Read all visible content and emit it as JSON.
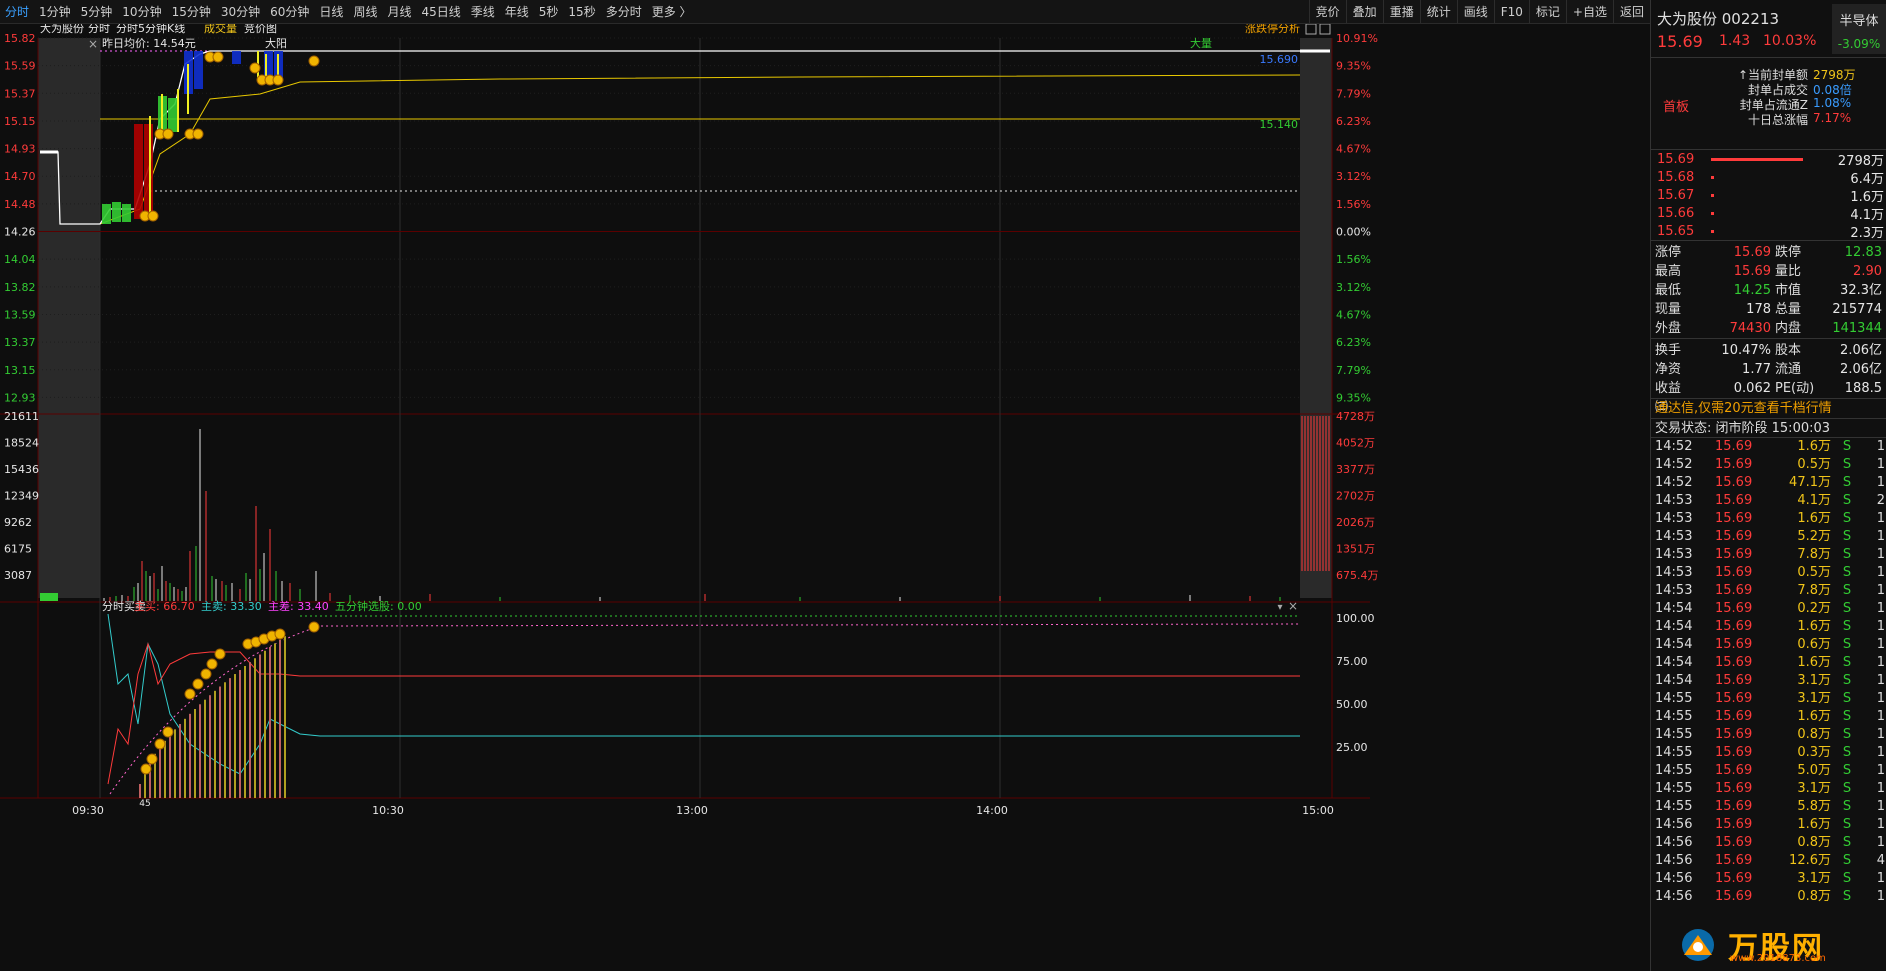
{
  "toolbar": {
    "periods": [
      "分时",
      "1分钟",
      "5分钟",
      "10分钟",
      "15分钟",
      "30分钟",
      "60分钟",
      "日线",
      "周线",
      "月线",
      "45日线",
      "季线",
      "年线",
      "5秒",
      "15秒",
      "多分时",
      "更多 〉"
    ],
    "right": [
      "竞价",
      "叠加",
      "重播",
      "统计",
      "画线",
      "F10",
      "标记",
      "+自选",
      "返回"
    ]
  },
  "chart": {
    "stock_name": "大为股份",
    "tabs": [
      "分时",
      "分时5分钟K线",
      "成交量",
      "竞价图"
    ],
    "prev_avg": "昨日均价: 14.54元",
    "analysis": "涨跌停分析",
    "label_dayang": "大阳",
    "label_daliang": "大量",
    "line_label_1": "15.690",
    "line_label_2": "15.140",
    "price_left": [
      "15.82",
      "15.59",
      "15.37",
      "15.15",
      "14.93",
      "14.70",
      "14.48",
      "14.26",
      "14.04",
      "13.82",
      "13.59",
      "13.37",
      "13.15",
      "12.93"
    ],
    "pct_right": [
      "10.91%",
      "9.35%",
      "7.79%",
      "6.23%",
      "4.67%",
      "3.12%",
      "1.56%",
      "0.00%",
      "1.56%",
      "3.12%",
      "4.67%",
      "6.23%",
      "7.79%",
      "9.35%"
    ],
    "vol_left": [
      "21611",
      "18524",
      "15436",
      "12349",
      "9262",
      "6175",
      "3087"
    ],
    "vol_right": [
      "4728万",
      "4052万",
      "3377万",
      "2702万",
      "2026万",
      "1351万",
      "675.4万"
    ],
    "ind_title": "分时买卖",
    "ind_buy": "主买: 66.70",
    "ind_sell": "主卖: 33.30",
    "ind_diff": "主差: 33.40",
    "ind_pick": "五分钟选股: 0.00",
    "ind_right": [
      "100.00",
      "75.00",
      "50.00",
      "25.00"
    ],
    "time_labels": [
      "09:30",
      "10:30",
      "13:00",
      "14:00",
      "15:00"
    ],
    "extra_tick": "45"
  },
  "colors": {
    "up": "#ff3b3b",
    "down": "#33cc33",
    "avg": "#e8c800",
    "grid": "#3a0000",
    "bg": "#0e0e0e"
  },
  "panel": {
    "name": "大为股份 002213",
    "price": "15.69",
    "change": "1.43",
    "pct": "10.03%",
    "sector_name": "半导体",
    "sector_pct": "-3.09%",
    "seal_label": "首板",
    "seal": [
      {
        "k": "↑当前封单额",
        "v": "2798万",
        "c": "yellow"
      },
      {
        "k": "封单占成交",
        "v": "0.08倍",
        "c": "blue"
      },
      {
        "k": "封单占流通Z",
        "v": "1.08%",
        "c": "blue"
      },
      {
        "k": "十日总涨幅",
        "v": "7.17%",
        "c": "red"
      }
    ],
    "book": [
      {
        "p": "15.69",
        "v": "2798万",
        "w": 92
      },
      {
        "p": "15.68",
        "v": "6.4万",
        "w": 3
      },
      {
        "p": "15.67",
        "v": "1.6万",
        "w": 3
      },
      {
        "p": "15.66",
        "v": "4.1万",
        "w": 3
      },
      {
        "p": "15.65",
        "v": "2.3万",
        "w": 3
      }
    ],
    "stats1": [
      {
        "k": "涨停",
        "v": "15.69",
        "vc": "red",
        "k2": "跌停",
        "v2": "12.83",
        "v2c": "green"
      },
      {
        "k": "最高",
        "v": "15.69",
        "vc": "red",
        "k2": "量比",
        "v2": "2.90",
        "v2c": "red"
      },
      {
        "k": "最低",
        "v": "14.25",
        "vc": "green",
        "k2": "市值",
        "v2": "32.3亿",
        "v2c": "white"
      },
      {
        "k": "现量",
        "v": "178",
        "vc": "white",
        "k2": "总量",
        "v2": "215774",
        "v2c": "white"
      },
      {
        "k": "外盘",
        "v": "74430",
        "vc": "red",
        "k2": "内盘",
        "v2": "141344",
        "v2c": "green"
      }
    ],
    "stats2": [
      {
        "k": "换手",
        "v": "10.47%",
        "vc": "white",
        "k2": "股本",
        "v2": "2.06亿",
        "v2c": "white"
      },
      {
        "k": "净资",
        "v": "1.77",
        "vc": "white",
        "k2": "流通",
        "v2": "2.06亿",
        "v2c": "white"
      },
      {
        "k": "收益㈢",
        "v": "0.062",
        "vc": "white",
        "k2": "PE(动)",
        "v2": "188.5",
        "v2c": "white"
      }
    ],
    "promo": "通达信,仅需20元查看千档行情",
    "trade_state": "交易状态: 闭市阶段 15:00:03",
    "ticks": [
      {
        "t": "14:52",
        "p": "15.69",
        "v": "1.6万",
        "d": "S",
        "n": "1"
      },
      {
        "t": "14:52",
        "p": "15.69",
        "v": "0.5万",
        "d": "S",
        "n": "1"
      },
      {
        "t": "14:52",
        "p": "15.69",
        "v": "47.1万",
        "d": "S",
        "n": "1"
      },
      {
        "t": "14:53",
        "p": "15.69",
        "v": "4.1万",
        "d": "S",
        "n": "2"
      },
      {
        "t": "14:53",
        "p": "15.69",
        "v": "1.6万",
        "d": "S",
        "n": "1"
      },
      {
        "t": "14:53",
        "p": "15.69",
        "v": "5.2万",
        "d": "S",
        "n": "1"
      },
      {
        "t": "14:53",
        "p": "15.69",
        "v": "7.8万",
        "d": "S",
        "n": "1"
      },
      {
        "t": "14:53",
        "p": "15.69",
        "v": "0.5万",
        "d": "S",
        "n": "1"
      },
      {
        "t": "14:53",
        "p": "15.69",
        "v": "7.8万",
        "d": "S",
        "n": "1"
      },
      {
        "t": "14:54",
        "p": "15.69",
        "v": "0.2万",
        "d": "S",
        "n": "1"
      },
      {
        "t": "14:54",
        "p": "15.69",
        "v": "1.6万",
        "d": "S",
        "n": "1"
      },
      {
        "t": "14:54",
        "p": "15.69",
        "v": "0.6万",
        "d": "S",
        "n": "1"
      },
      {
        "t": "14:54",
        "p": "15.69",
        "v": "1.6万",
        "d": "S",
        "n": "1"
      },
      {
        "t": "14:54",
        "p": "15.69",
        "v": "3.1万",
        "d": "S",
        "n": "1"
      },
      {
        "t": "14:55",
        "p": "15.69",
        "v": "3.1万",
        "d": "S",
        "n": "1"
      },
      {
        "t": "14:55",
        "p": "15.69",
        "v": "1.6万",
        "d": "S",
        "n": "1"
      },
      {
        "t": "14:55",
        "p": "15.69",
        "v": "0.8万",
        "d": "S",
        "n": "1"
      },
      {
        "t": "14:55",
        "p": "15.69",
        "v": "0.3万",
        "d": "S",
        "n": "1"
      },
      {
        "t": "14:55",
        "p": "15.69",
        "v": "5.0万",
        "d": "S",
        "n": "1"
      },
      {
        "t": "14:55",
        "p": "15.69",
        "v": "3.1万",
        "d": "S",
        "n": "1"
      },
      {
        "t": "14:55",
        "p": "15.69",
        "v": "5.8万",
        "d": "S",
        "n": "1"
      },
      {
        "t": "14:56",
        "p": "15.69",
        "v": "1.6万",
        "d": "S",
        "n": "1"
      },
      {
        "t": "14:56",
        "p": "15.69",
        "v": "0.8万",
        "d": "S",
        "n": "1"
      },
      {
        "t": "14:56",
        "p": "15.69",
        "v": "12.6万",
        "d": "S",
        "n": "4"
      },
      {
        "t": "14:56",
        "p": "15.69",
        "v": "3.1万",
        "d": "S",
        "n": "1"
      },
      {
        "t": "14:56",
        "p": "15.69",
        "v": "0.8万",
        "d": "S",
        "n": "1"
      }
    ],
    "logo_text": "万股网",
    "logo_url": "www.2018873.com"
  }
}
